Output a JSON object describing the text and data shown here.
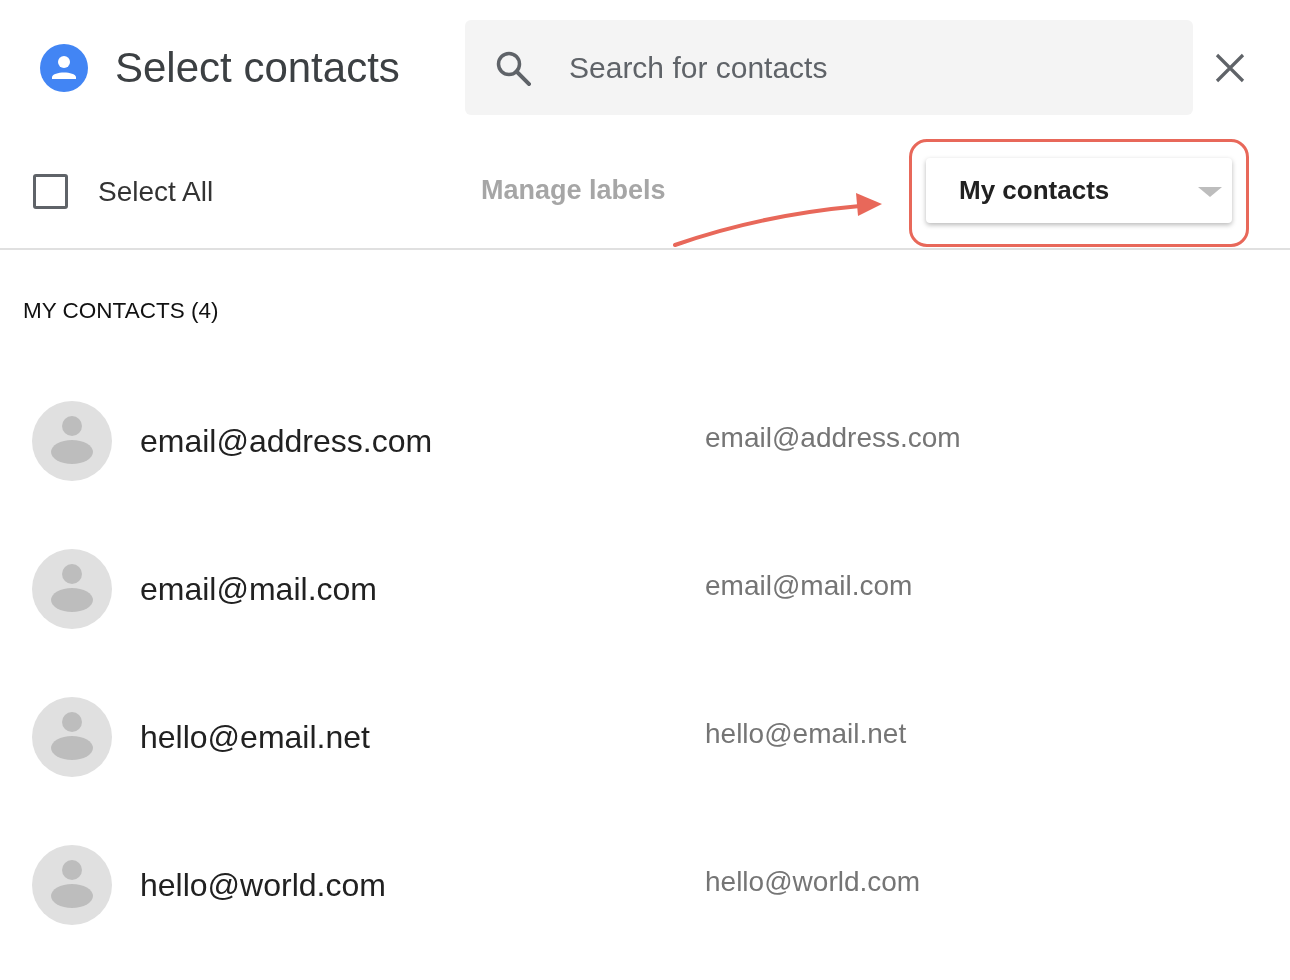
{
  "header": {
    "title": "Select contacts",
    "search": {
      "placeholder": "Search for contacts"
    }
  },
  "toolbar": {
    "select_all": {
      "label": "Select All",
      "checked": false
    },
    "manage_labels": {
      "label": "Manage labels",
      "disabled": true
    },
    "filter": {
      "label": "My contacts",
      "highlighted": true
    }
  },
  "section": {
    "heading": "MY CONTACTS (4)",
    "contacts": [
      {
        "name": "email@address.com",
        "email": "email@address.com"
      },
      {
        "name": "email@mail.com",
        "email": "email@mail.com"
      },
      {
        "name": "hello@email.net",
        "email": "hello@email.net"
      },
      {
        "name": "hello@world.com",
        "email": "hello@world.com"
      }
    ]
  }
}
